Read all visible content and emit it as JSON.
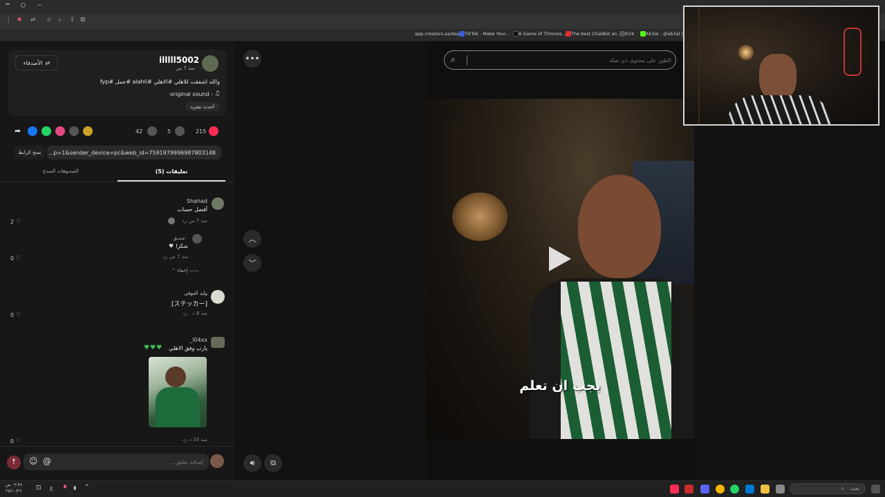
{
  "browser": {
    "bookmarks": [
      {
        "label": "app.creators.sa/das..."
      },
      {
        "label": "TikTok - Make Your..."
      },
      {
        "label": "A Game of Thrones..."
      },
      {
        "label": "The best ChatBot an..."
      },
      {
        "label": "Kick"
      },
      {
        "label": "Ab3al - @ab3al |..."
      }
    ]
  },
  "post": {
    "username": "illlll5002",
    "meta": "· منذ 7 س",
    "friends_button": "الأصدقاء",
    "caption": "والله اشفقت للاهلي #الاهلي #alahli #جمل #fyp",
    "sound": "original sound - ",
    "latest_share": "أحدث نشره",
    "likes": "215",
    "comments_count": "5",
    "saves": "42",
    "link_url": "...p=1&sender_device=pc&web_id=7591979996987803148",
    "copy_link": "نسخ الرابط",
    "tab_comments": "تعليقات (5)",
    "tab_creator_videos": "الفيديوهات المبدع"
  },
  "comments": [
    {
      "author": "Shahad",
      "text": "أفضل حساب",
      "time": "منذ 7 س",
      "reply": "رد",
      "likes": "2"
    },
    {
      "author": "· صديق",
      "text": "شكرا",
      "time": "منذ 7 س",
      "reply": "رد",
      "likes": "0"
    },
    {
      "author": "وليد العوفي",
      "text": "[ステッカー]",
      "time": "منذ 8 د",
      "reply": "رد",
      "likes": "0"
    },
    {
      "author": "_l04xx",
      "text": "يارب وفق الاهلي",
      "time": "منذ 33 د",
      "reply": "رد",
      "likes": "0"
    }
  ],
  "hide_replies": "إخفاء",
  "comment_input": {
    "placeholder": "إضافة تعليق..."
  },
  "search": {
    "placeholder": "الطور على محتوى ذي صلة"
  },
  "video": {
    "subtitle": "يجب ان تعلم"
  },
  "taskbar": {
    "time": "٠٢:٣٨ ص",
    "date": "٢٧/١٠/٢٦",
    "search_placeholder": "بحث"
  },
  "colors": {
    "accent": "#fe2c55",
    "panel": "#171717"
  }
}
